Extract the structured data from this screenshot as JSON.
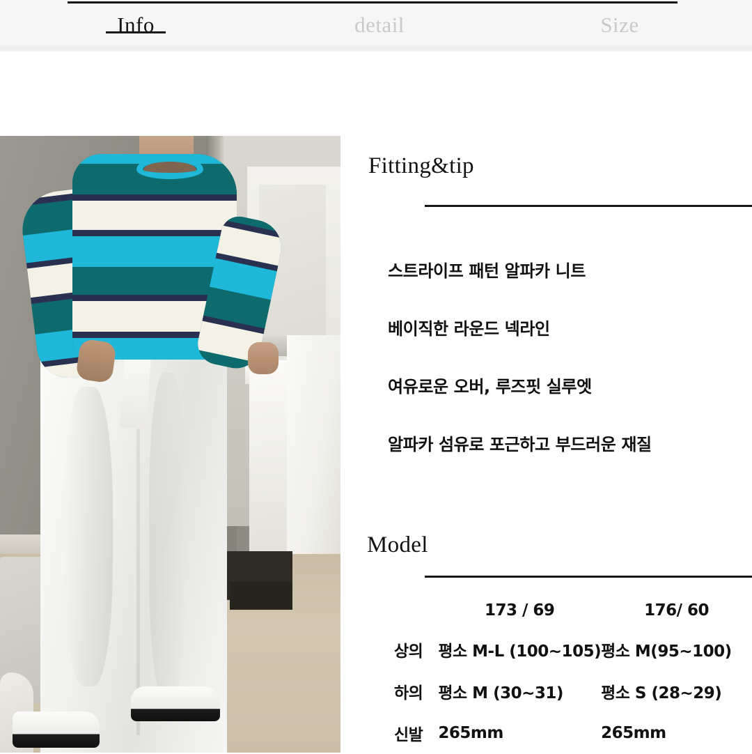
{
  "tabs": [
    {
      "label": "Info",
      "state": "active"
    },
    {
      "label": "detail",
      "state": "inactive"
    },
    {
      "label": "Size",
      "state": "inactive"
    }
  ],
  "photo": {
    "alt": "model-wearing-striped-alpaca-knit-and-white-wide-pants",
    "colors": {
      "knit_teal": "#0d6b6e",
      "knit_cyan": "#1fb8d8",
      "knit_cream": "#f4f1e6",
      "knit_navy": "#2a3050",
      "pants_white": "#f6f6f4"
    }
  },
  "fitting": {
    "heading": "Fitting&tip",
    "points": [
      "스트라이프 패턴 알파카 니트",
      "베이직한 라운드 넥라인",
      "여유로운 오버, 루즈핏 실루엣",
      "알파카 섬유로 포근하고 부드러운 재질"
    ]
  },
  "model": {
    "heading": "Model",
    "columns": [
      "",
      "173 / 69",
      "176/ 60"
    ],
    "rows": [
      {
        "label": "상의",
        "a": "평소 M-L (100~105)",
        "b": "평소 M(95~100)"
      },
      {
        "label": "하의",
        "a": "평소 M (30~31)",
        "b": "평소 S (28~29)"
      },
      {
        "label": "신발",
        "a": "265mm",
        "b": "265mm"
      }
    ]
  },
  "theme": {
    "accent": "#111111",
    "tab_active": "#141414",
    "tab_inactive": "#c9c9c9",
    "background": "#ffffff",
    "tabbar_background": "#f7f7f7"
  }
}
